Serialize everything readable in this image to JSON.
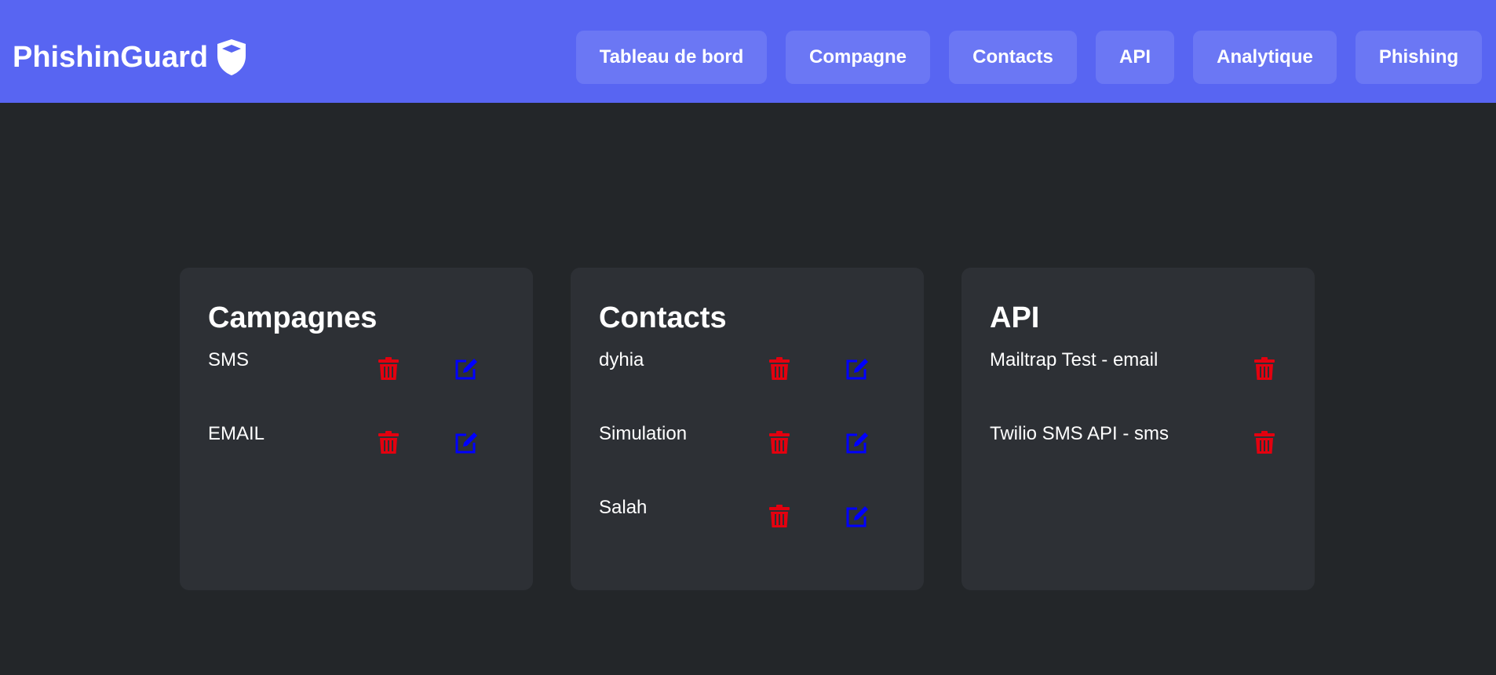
{
  "app": {
    "brand": "PhishinGuard",
    "brand_icon": "shield-icon",
    "colors": {
      "header_bg": "#5865f2",
      "nav_button_bg": "#6b77f4",
      "page_bg": "#232629",
      "card_bg": "#2d3035",
      "delete_icon": "#e3000f",
      "edit_icon": "#0000ff"
    }
  },
  "nav": {
    "items": [
      {
        "label": "Tableau de bord"
      },
      {
        "label": "Compagne"
      },
      {
        "label": "Contacts"
      },
      {
        "label": "API"
      },
      {
        "label": "Analytique"
      },
      {
        "label": "Phishing"
      }
    ]
  },
  "cards": {
    "campagnes": {
      "title": "Campagnes",
      "items": [
        {
          "label": "SMS",
          "actions": [
            "trash-icon",
            "edit-icon"
          ]
        },
        {
          "label": "EMAIL",
          "actions": [
            "trash-icon",
            "edit-icon"
          ]
        }
      ]
    },
    "contacts": {
      "title": "Contacts",
      "items": [
        {
          "label": "dyhia",
          "actions": [
            "trash-icon",
            "edit-icon"
          ]
        },
        {
          "label": "Simulation",
          "actions": [
            "trash-icon",
            "edit-icon"
          ]
        },
        {
          "label": "Salah",
          "actions": [
            "trash-icon",
            "edit-icon"
          ]
        }
      ]
    },
    "api": {
      "title": "API",
      "items": [
        {
          "label": "Mailtrap Test - email",
          "actions": [
            "trash-icon"
          ]
        },
        {
          "label": "Twilio SMS API - sms",
          "actions": [
            "trash-icon"
          ]
        }
      ]
    }
  }
}
